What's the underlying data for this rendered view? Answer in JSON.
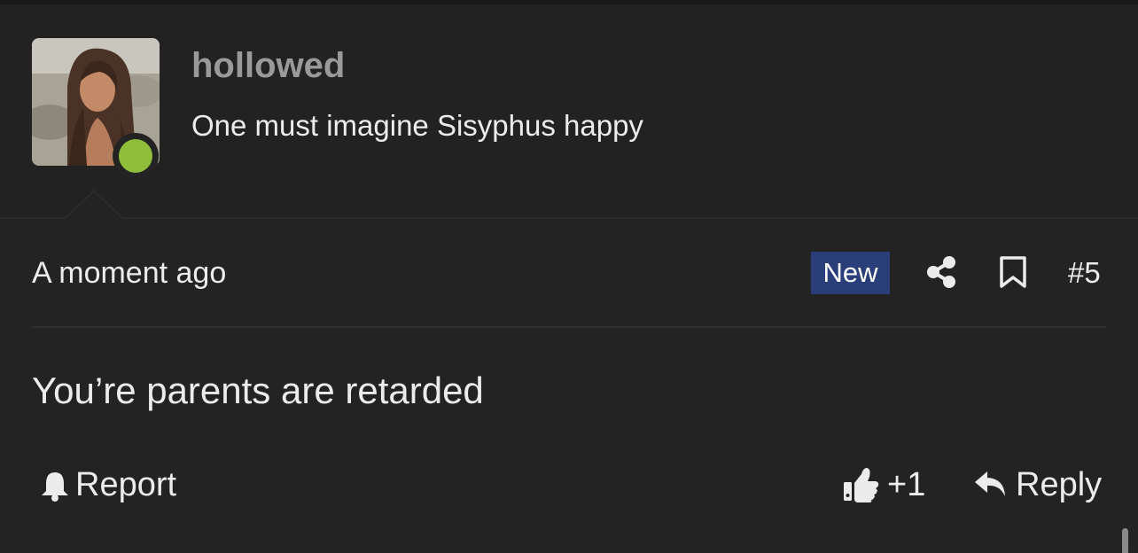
{
  "post": {
    "author": {
      "username": "hollowed",
      "signature": "One must imagine Sisyphus happy",
      "status": "online",
      "status_color": "#8fbe3a"
    },
    "meta": {
      "timestamp": "A moment ago",
      "badge": "New",
      "badge_color": "#2a3f7a",
      "post_number": "#5",
      "icons": [
        "share-icon",
        "bookmark-icon"
      ]
    },
    "body": "You’re parents are retarded",
    "actions": {
      "report_label": "Report",
      "like_count": "+1",
      "reply_label": "Reply",
      "icons": [
        "bell-icon",
        "thumbs-up-icon",
        "reply-icon"
      ]
    }
  }
}
